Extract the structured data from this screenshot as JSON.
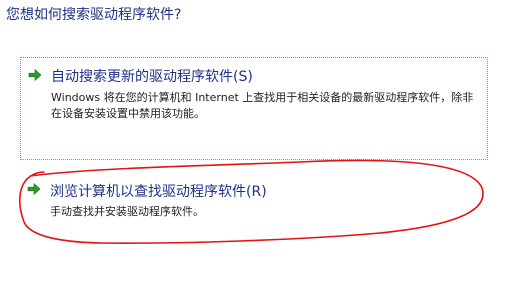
{
  "page": {
    "question": "您想如何搜索驱动程序软件?"
  },
  "options": [
    {
      "title": "自动搜索更新的驱动程序软件(S)",
      "description": "Windows 将在您的计算机和 Internet 上查找用于相关设备的最新驱动程序软件，除非在设备安装设置中禁用该功能。",
      "icon": "green-arrow-icon"
    },
    {
      "title": "浏览计算机以查找驱动程序软件(R)",
      "description": "手动查找并安装驱动程序软件。",
      "icon": "green-arrow-icon"
    }
  ],
  "colors": {
    "title_blue": "#1e3287",
    "arrow_green": "#2f9a2a",
    "focus_border": "#5aa6c8",
    "annotation_red": "#e01414"
  }
}
